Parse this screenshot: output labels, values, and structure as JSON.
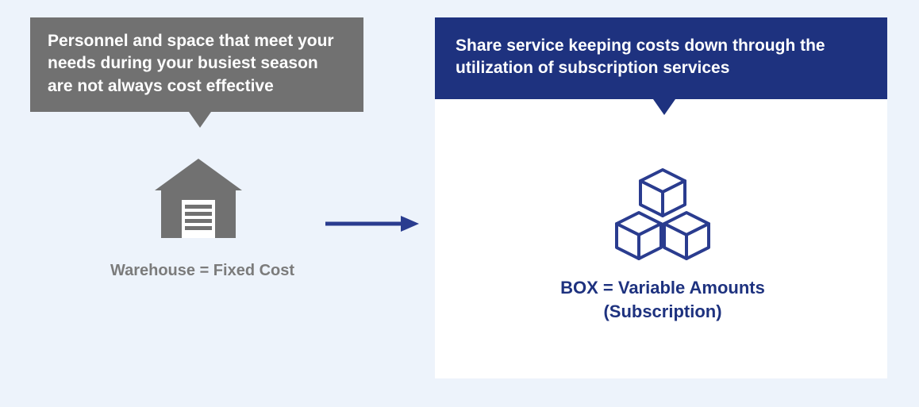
{
  "left": {
    "callout_text": "Personnel and space that meet your needs during your busiest season are not always cost effective",
    "icon_name": "warehouse-icon",
    "caption": "Warehouse = Fixed Cost"
  },
  "right": {
    "header_text": "Share service keeping costs down through the utilization of subscription services",
    "icon_name": "boxes-icon",
    "caption_line1": "BOX = Variable Amounts",
    "caption_line2": "(Subscription)"
  },
  "colors": {
    "background": "#edf3fb",
    "gray": "#717171",
    "navy": "#1e327f",
    "white": "#ffffff"
  }
}
